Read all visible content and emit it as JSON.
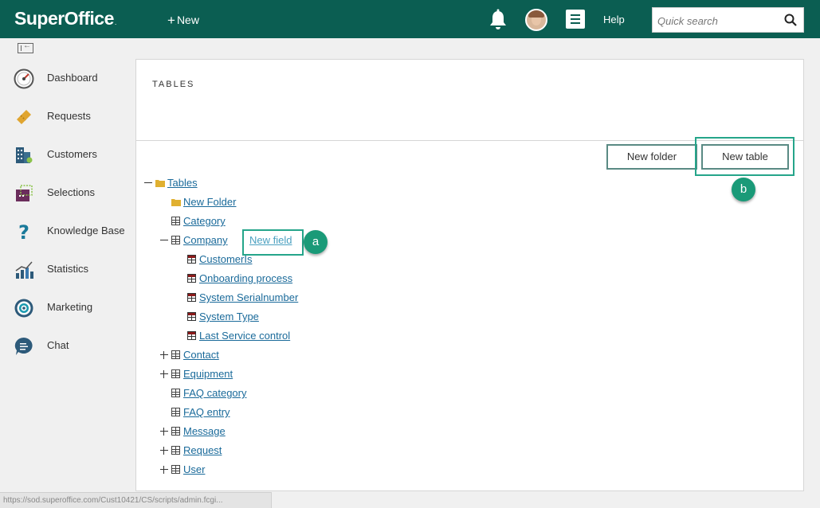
{
  "header": {
    "logo_text": "SuperOffice",
    "logo_dot": ".",
    "new_label": "New",
    "help_label": "Help",
    "search_placeholder": "Quick search"
  },
  "sidebar": {
    "items": [
      {
        "label": "Dashboard",
        "icon": "speedometer-icon"
      },
      {
        "label": "Requests",
        "icon": "ticket-icon"
      },
      {
        "label": "Customers",
        "icon": "building-icon"
      },
      {
        "label": "Selections",
        "icon": "selection-icon"
      },
      {
        "label": "Knowledge Base",
        "icon": "question-mark-icon"
      },
      {
        "label": "Statistics",
        "icon": "bar-chart-icon"
      },
      {
        "label": "Marketing",
        "icon": "target-icon"
      },
      {
        "label": "Chat",
        "icon": "chat-bubble-icon"
      }
    ]
  },
  "main": {
    "title": "TABLES",
    "new_folder_label": "New folder",
    "new_table_label": "New table",
    "new_field_label": "New field",
    "badge_a": "a",
    "badge_b": "b",
    "tree": [
      {
        "label": "Tables",
        "icon": "folder",
        "toggle": "minus"
      },
      {
        "label": "New Folder",
        "icon": "folder",
        "toggle": "none"
      },
      {
        "label": "Category",
        "icon": "table",
        "toggle": "none"
      },
      {
        "label": "Company",
        "icon": "table",
        "toggle": "minus"
      },
      {
        "label": "CustomerIs",
        "icon": "field",
        "toggle": "none"
      },
      {
        "label": "Onboarding process",
        "icon": "field",
        "toggle": "none"
      },
      {
        "label": "System Serialnumber",
        "icon": "field",
        "toggle": "none"
      },
      {
        "label": "System Type",
        "icon": "field",
        "toggle": "none"
      },
      {
        "label": "Last Service control",
        "icon": "field",
        "toggle": "none"
      },
      {
        "label": "Contact",
        "icon": "table",
        "toggle": "plus"
      },
      {
        "label": "Equipment",
        "icon": "table",
        "toggle": "plus"
      },
      {
        "label": "FAQ category",
        "icon": "table",
        "toggle": "none"
      },
      {
        "label": "FAQ entry",
        "icon": "table",
        "toggle": "none"
      },
      {
        "label": "Message",
        "icon": "table",
        "toggle": "plus"
      },
      {
        "label": "Request",
        "icon": "table",
        "toggle": "plus"
      },
      {
        "label": "User",
        "icon": "table",
        "toggle": "plus"
      }
    ]
  },
  "status_bar": {
    "url": "https://sod.superoffice.com/Cust10421/CS/scripts/admin.fcgi..."
  },
  "colors": {
    "header_bg": "#0b5e52",
    "highlight": "#25a58a",
    "badge": "#1a9a78",
    "link": "#1a6a9a"
  }
}
